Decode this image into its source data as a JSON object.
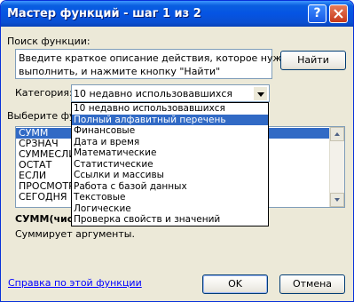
{
  "window": {
    "title": "Мастер функций - шаг 1 из 2",
    "help_glyph": "?"
  },
  "search": {
    "label": "Поиск функции:",
    "text_line1": "Введите краткое описание действия, которое нужно",
    "text_line2": "выполнить, и нажмите кнопку \"Найти\"",
    "find_button": "Найти"
  },
  "category": {
    "label": "Категория:",
    "value": "10 недавно использовавшихся",
    "options": [
      "10 недавно использовавшихся",
      "Полный алфавитный перечень",
      "Финансовые",
      "Дата и время",
      "Математические",
      "Статистические",
      "Ссылки и массивы",
      "Работа с базой данных",
      "Текстовые",
      "Логические",
      "Проверка свойств и значений"
    ],
    "highlighted_index": 1
  },
  "functions": {
    "label": "Выберите фун",
    "items": [
      "СУММ",
      "СРЗНАЧ",
      "СУММЕСЛИ",
      "ОСТАТ",
      "ЕСЛИ",
      "ПРОСМОТР",
      "СЕГОДНЯ"
    ],
    "selected_index": 0
  },
  "signature": "СУММ(чис",
  "description": "Суммирует аргументы.",
  "footer": {
    "help_link": "Справка по этой функции",
    "ok_button": "OK",
    "cancel_button": "Отмена"
  },
  "colors": {
    "title_bar": "#0554e3",
    "selection": "#316ac5",
    "dialog_bg": "#ece9d8",
    "link": "#0000ff"
  },
  "icons": [
    "help-icon",
    "close-icon",
    "dropdown-arrow-icon",
    "scroll-up-icon",
    "scroll-down-icon"
  ]
}
